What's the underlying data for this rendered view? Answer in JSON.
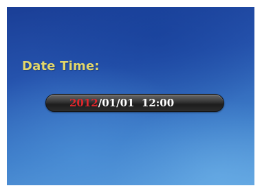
{
  "screen": {
    "title": "Date Time:",
    "date_time": {
      "year": "2012",
      "rest": "/01/01  12:00"
    }
  },
  "colors": {
    "title": "#e3d76a",
    "year_highlight": "#e0262c",
    "text": "#ffffff",
    "background_top": "#1a3e96",
    "background_bottom": "#5fa2de"
  }
}
